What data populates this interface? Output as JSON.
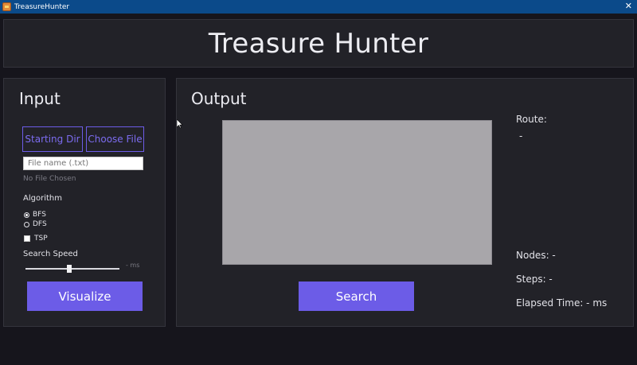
{
  "window": {
    "title": "TreasureHunter",
    "close_glyph": "✕"
  },
  "header": {
    "title": "Treasure Hunter"
  },
  "input_panel": {
    "heading": "Input",
    "starting_dir_label": "Starting Dir",
    "choose_file_label": "Choose File",
    "file_name_placeholder": "File name (.txt)",
    "file_status": "No File Chosen",
    "algorithm_label": "Algorithm",
    "algorithms": [
      {
        "label": "BFS",
        "checked": true
      },
      {
        "label": "DFS",
        "checked": false
      }
    ],
    "tsp_label": "TSP",
    "tsp_checked": false,
    "search_speed_label": "Search Speed",
    "search_speed_value": 0.47,
    "search_speed_unit_text": "- ms",
    "visualize_label": "Visualize"
  },
  "output_panel": {
    "heading": "Output",
    "route_label": "Route:",
    "route_value": "-",
    "nodes_text": "Nodes: -",
    "steps_text": "Steps: -",
    "elapsed_text": "Elapsed Time: - ms",
    "search_label": "Search"
  },
  "colors": {
    "accent": "#6c5ce7",
    "background": "#16151c",
    "panel": "#222228",
    "titlebar": "#0b4a8a",
    "canvas": "#a8a6aa"
  },
  "icons": {
    "app_icon": "treasure-chest-icon",
    "close_icon": "close-icon",
    "cursor_icon": "mouse-pointer-icon"
  }
}
